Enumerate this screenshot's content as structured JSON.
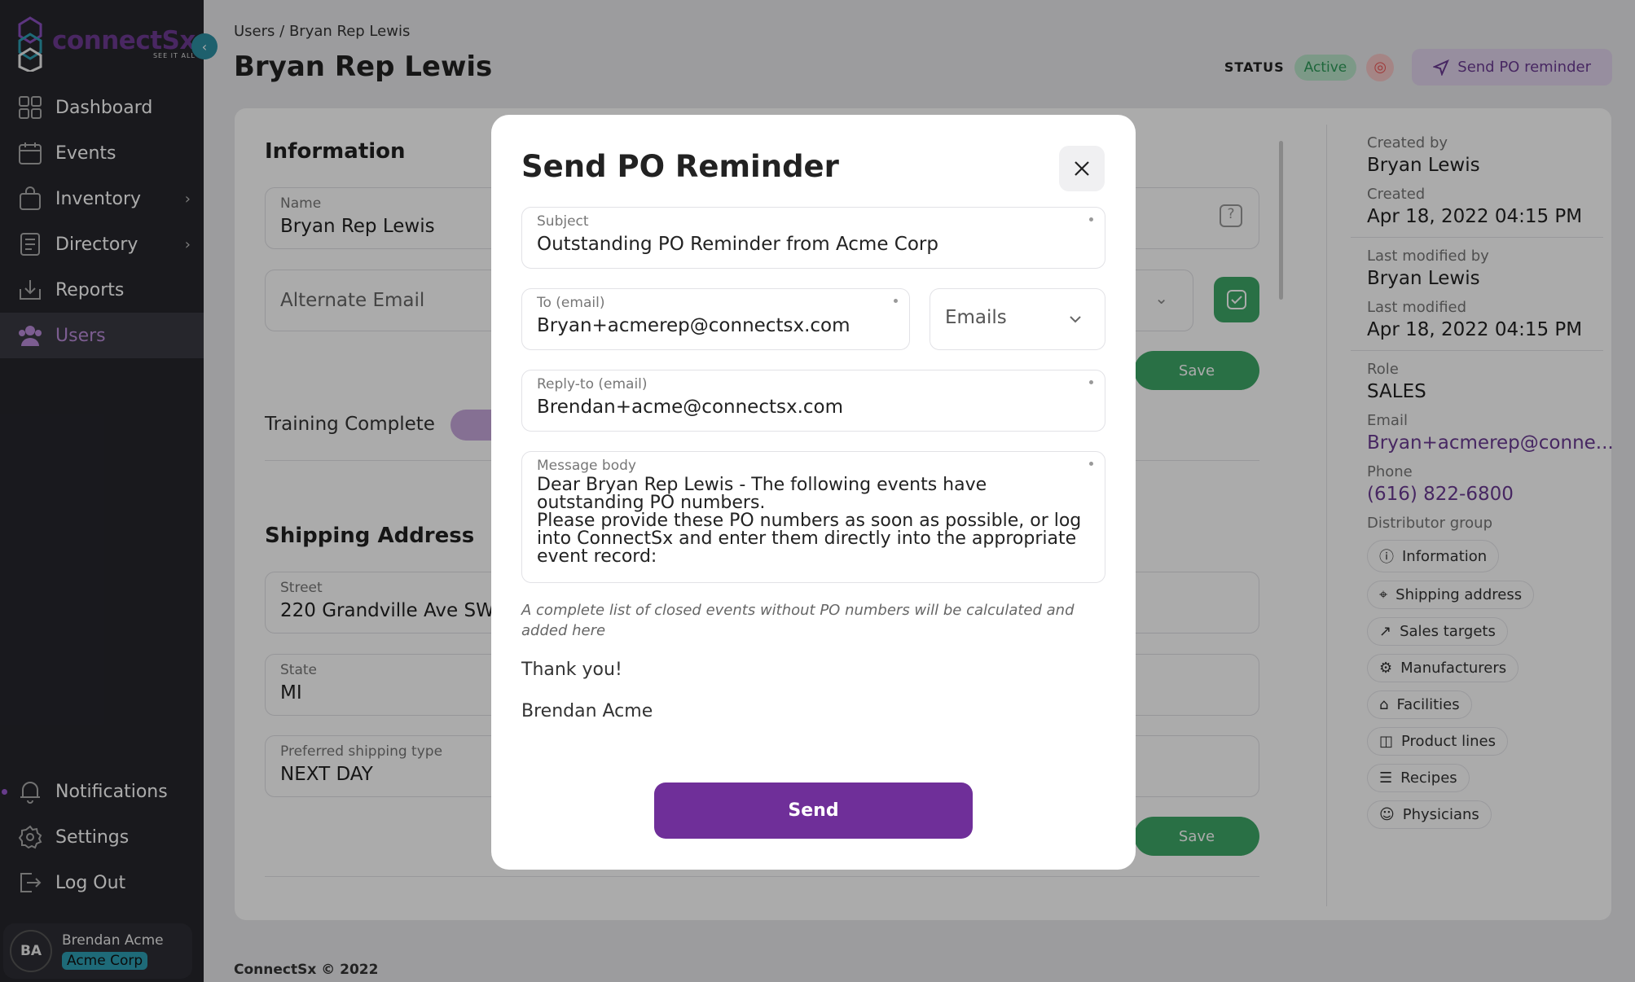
{
  "brand": {
    "name": "connectSx",
    "tagline": "SEE IT ALL"
  },
  "nav": {
    "items": [
      {
        "label": "Dashboard",
        "icon": "dashboard-icon"
      },
      {
        "label": "Events",
        "icon": "calendar-icon"
      },
      {
        "label": "Inventory",
        "icon": "bag-icon"
      },
      {
        "label": "Directory",
        "icon": "book-icon"
      },
      {
        "label": "Reports",
        "icon": "download-icon"
      },
      {
        "label": "Users",
        "icon": "users-icon"
      }
    ],
    "bottom": [
      {
        "label": "Notifications"
      },
      {
        "label": "Settings"
      },
      {
        "label": "Log Out"
      }
    ]
  },
  "user": {
    "initials": "BA",
    "name": "Brendan Acme",
    "org": "Acme Corp"
  },
  "breadcrumb": {
    "root": "Users",
    "sep": "/",
    "current": "Bryan Rep Lewis"
  },
  "page": {
    "title": "Bryan Rep Lewis",
    "status_label": "STATUS",
    "status": "Active",
    "po_button": "Send PO reminder"
  },
  "info": {
    "title": "Information",
    "name_label": "Name",
    "name": "Bryan Rep Lewis",
    "alt_email_placeholder": "Alternate Email",
    "training_label": "Training Complete",
    "save": "Save"
  },
  "shipping": {
    "title": "Shipping Address",
    "street_label": "Street",
    "street": "220 Grandville Ave SW",
    "state_label": "State",
    "state": "MI",
    "ship_label": "Preferred shipping type",
    "ship": "NEXT DAY",
    "save": "Save"
  },
  "meta": {
    "created_by_label": "Created by",
    "created_by": "Bryan Lewis",
    "created_label": "Created",
    "created": "Apr 18, 2022 04:15 PM",
    "modified_by_label": "Last modified by",
    "modified_by": "Bryan Lewis",
    "modified_label": "Last modified",
    "modified": "Apr 18, 2022 04:15 PM",
    "role_label": "Role",
    "role": "SALES",
    "email_label": "Email",
    "email": "Bryan+acmerep@conne...",
    "phone_label": "Phone",
    "phone": "(616) 822-6800",
    "group_label": "Distributor group"
  },
  "sections": [
    "Information",
    "Shipping address",
    "Sales targets",
    "Manufacturers",
    "Facilities",
    "Product lines",
    "Recipes",
    "Physicians"
  ],
  "footer": "ConnectSx © 2022",
  "modal": {
    "title": "Send PO Reminder",
    "subject_label": "Subject",
    "subject": "Outstanding PO Reminder from Acme Corp",
    "to_label": "To (email)",
    "to": "Bryan+acmerep@connectsx.com",
    "emails_select": "Emails",
    "reply_label": "Reply-to (email)",
    "reply": "Brendan+acme@connectsx.com",
    "body_label": "Message body",
    "body": "Dear Bryan Rep Lewis - The following events have outstanding PO numbers.\nPlease provide these PO numbers as soon as possible, or log into ConnectSx and enter them directly into the appropriate event record:",
    "note": "A complete list of closed events without PO numbers will be calculated and added here",
    "thanks": "Thank you!",
    "signature": "Brendan Acme",
    "send": "Send"
  },
  "colors": {
    "brand": "#6f2f99",
    "accent": "#2d8fa3",
    "success": "#3ea868",
    "sidebar": "#26262c"
  }
}
